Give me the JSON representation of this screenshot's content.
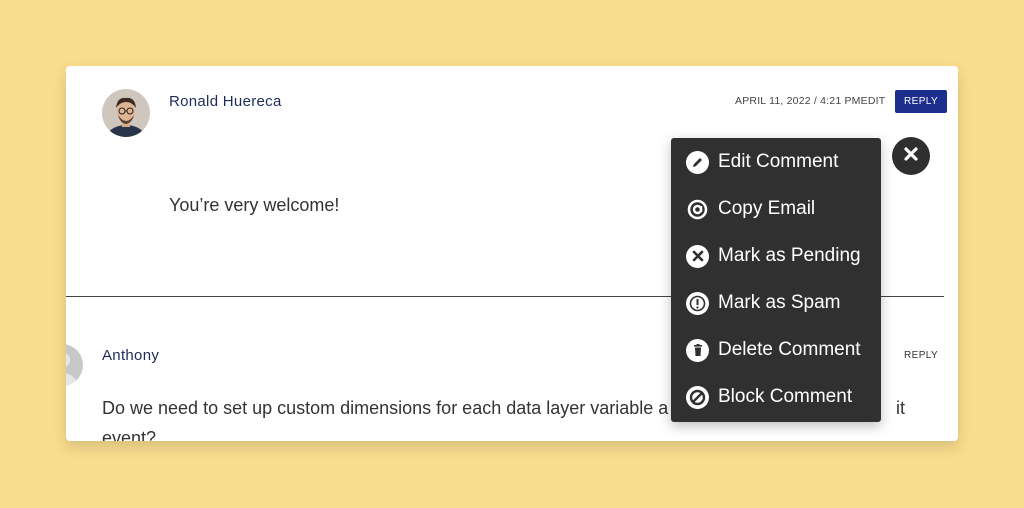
{
  "comments": [
    {
      "author": "Ronald Huereca",
      "date": "APRIL 11, 2022 / 4:21 PM",
      "edit_label": "EDIT",
      "reply_label": "REPLY",
      "text": "You’re very welcome!"
    },
    {
      "author": "Anthony",
      "reply_label": "REPLY",
      "text": "Do we need to set up custom dimensions for each data layer variable a",
      "text_tail": "it",
      "text_line2": "event?"
    }
  ],
  "context_menu": {
    "items": [
      {
        "label": "Edit Comment",
        "icon": "pencil-icon"
      },
      {
        "label": "Copy Email",
        "icon": "at-sign-icon"
      },
      {
        "label": "Mark as Pending",
        "icon": "x-circle-icon"
      },
      {
        "label": "Mark as Spam",
        "icon": "exclamation-circle-icon"
      },
      {
        "label": "Delete Comment",
        "icon": "trash-icon"
      },
      {
        "label": "Block Comment",
        "icon": "block-icon"
      }
    ],
    "close_icon": "close-icon"
  },
  "colors": {
    "background": "#f9dd8e",
    "reply_button": "#1d2f8c",
    "menu": "#303030",
    "author_name": "#1e2d58"
  }
}
